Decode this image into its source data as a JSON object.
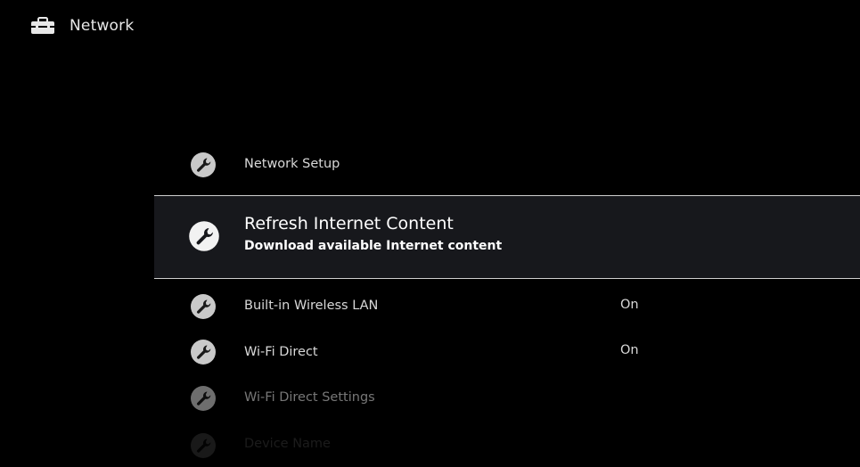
{
  "header": {
    "title": "Network",
    "icon": "toolbox-icon"
  },
  "menu": {
    "items": [
      {
        "label": "Network Setup",
        "value": "",
        "icon": "wrench-icon"
      },
      {
        "label": "Refresh Internet Content",
        "description": "Download available Internet content",
        "icon": "wrench-icon",
        "selected": true
      },
      {
        "label": "Built-in Wireless LAN",
        "value": "On",
        "icon": "wrench-icon"
      },
      {
        "label": "Wi-Fi Direct",
        "value": "On",
        "icon": "wrench-icon"
      },
      {
        "label": "Wi-Fi Direct Settings",
        "value": "",
        "icon": "wrench-icon"
      },
      {
        "label": "Device Name",
        "value": "",
        "icon": "wrench-icon"
      }
    ]
  },
  "colors": {
    "background": "#000000",
    "selected_background": "#17181c",
    "text": "#d8d8d8",
    "selected_text": "#ffffff"
  }
}
